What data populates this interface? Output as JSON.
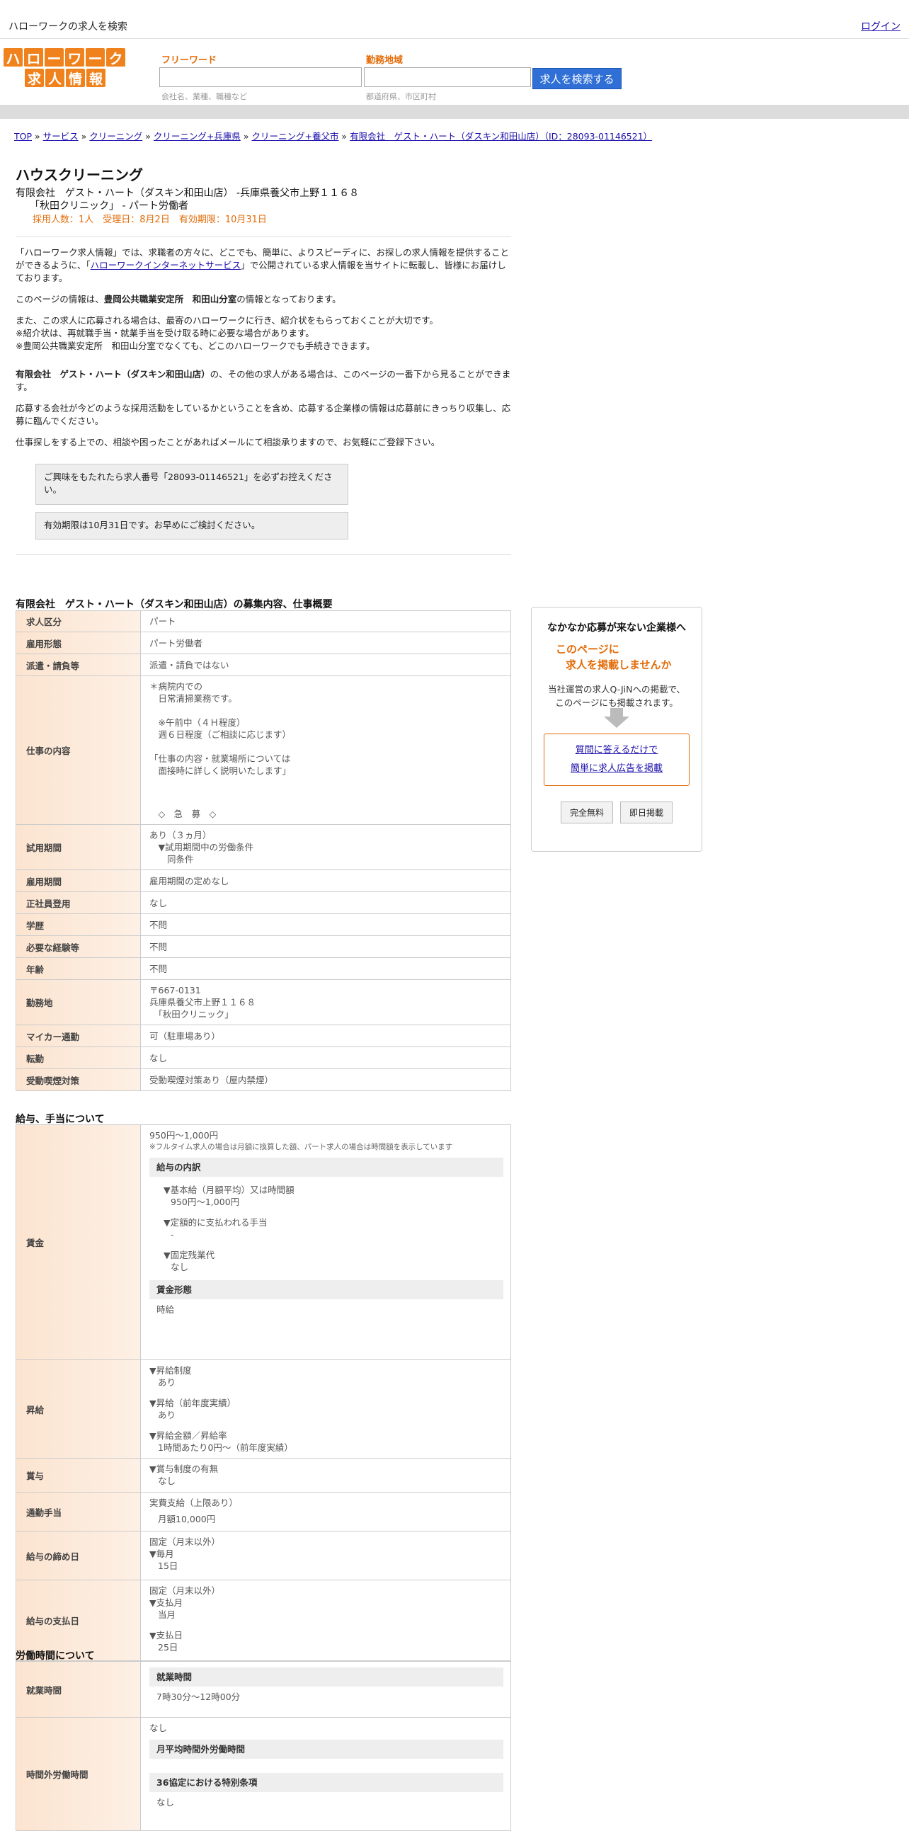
{
  "header": {
    "site_title": "ハローワークの求人を検索",
    "login": "ログイン"
  },
  "logo": {
    "line1": [
      "ハ",
      "ロ",
      "ー",
      "ワ",
      "ー",
      "ク"
    ],
    "line2": [
      "求",
      "人",
      "情",
      "報"
    ]
  },
  "search": {
    "freeword_label": "フリーワード",
    "freeword_hint": "会社名、業種、職種など",
    "area_label": "勤務地域",
    "area_hint": "都道府県、市区町村",
    "button": "求人を検索する"
  },
  "breadcrumb": {
    "items": [
      "TOP",
      "サービス",
      "クリーニング",
      "クリーニング+兵庫県",
      "クリーニング+養父市",
      "有限会社　ゲスト・ハート（ダスキン和田山店）（ID：28093-01146521）"
    ],
    "separator": " » "
  },
  "job": {
    "title": "ハウスクリーニング",
    "company_line": "有限会社　ゲスト・ハート（ダスキン和田山店） -兵庫県養父市上野１１６８",
    "clinic_line": "「秋田クリニック」 - パート労働者",
    "meta": "採用人数：1人　受理日：8月2日　有効期限：10月31日"
  },
  "intro": {
    "p1_a": "「ハローワーク求人情報」では、求職者の方々に、どこでも、簡単に、よりスピーディに、お探しの求人情報を提供することができるように、「",
    "p1_link": "ハローワークインターネットサービス",
    "p1_b": "」で公開されている求人情報を当サイトに転載し、皆様にお届けしております。",
    "p2_a": "このページの情報は、",
    "p2_bold": "豊岡公共職業安定所　和田山分室",
    "p2_b": "の情報となっております。",
    "p3_1": "また、この求人に応募される場合は、最寄のハローワークに行き、紹介状をもらっておくことが大切です。",
    "p3_2": "※紹介状は、再就職手当・就業手当を受け取る時に必要な場合があります。",
    "p3_3": "※豊岡公共職業安定所　和田山分室でなくても、どこのハローワークでも手続きできます。",
    "p4_bold": "有限会社　ゲスト・ハート（ダスキン和田山店）",
    "p4_b": "の、その他の求人がある場合は、このページの一番下から見ることができます。",
    "p5": "応募する会社が今どのような採用活動をしているかということを含め、応募する企業様の情報は応募前にきっちり収集し、応募に臨んでください。",
    "p6": "仕事探しをする上での、相談や困ったことがあればメールにて相談承りますので、お気軽にご登録下さい。",
    "notice1": "ご興味をもたれたら求人番号「28093-01146521」を必ずお控えください。",
    "notice2": "有効期限は10月31日です。お早めにご検討ください。"
  },
  "overview": {
    "heading": "有限会社　ゲスト・ハート（ダスキン和田山店）の募集内容、仕事概要",
    "rows": [
      {
        "label": "求人区分",
        "value": "パート"
      },
      {
        "label": "雇用形態",
        "value": "パート労働者"
      },
      {
        "label": "派遣・請負等",
        "value": "派遣・請負ではない"
      },
      {
        "label": "仕事の内容",
        "lines": [
          "＊病院内での",
          "　日常清掃業務です。",
          "",
          "　※午前中（４Ｈ程度）",
          "　週６日程度（ご相談に応じます）",
          "",
          "「仕事の内容・就業場所については",
          "　面接時に詳しく説明いたします」",
          "",
          "",
          "",
          "　◇　急　募　◇"
        ]
      },
      {
        "label": "試用期間",
        "lines": [
          "あり（３ヵ月）",
          "　▼試用期間中の労働条件",
          "　　同条件"
        ]
      },
      {
        "label": "雇用期間",
        "value": "雇用期間の定めなし"
      },
      {
        "label": "正社員登用",
        "value": "なし"
      },
      {
        "label": "学歴",
        "value": "不問"
      },
      {
        "label": "必要な経験等",
        "value": "不問"
      },
      {
        "label": "年齢",
        "value": "不問"
      },
      {
        "label": "勤務地",
        "lines": [
          "〒667-0131",
          "兵庫県養父市上野１１６８",
          "　「秋田クリニック」"
        ]
      },
      {
        "label": "マイカー通勤",
        "value": "可（駐車場あり）"
      },
      {
        "label": "転勤",
        "value": "なし"
      },
      {
        "label": "受動喫煙対策",
        "value": "受動喫煙対策あり（屋内禁煙）"
      }
    ]
  },
  "salary": {
    "heading": "給与、手当について",
    "wage_label": "賃金",
    "wage_range": "950円〜1,000円",
    "wage_note": "※フルタイム求人の場合は月額に換算した額、パート求人の場合は時間額を表示しています",
    "breakdown_head": "給与の内訳",
    "b1_title": "▼基本給（月額平均）又は時間額",
    "b1_value": "950円〜1,000円",
    "b2_title": "▼定額的に支払われる手当",
    "b2_value": "-",
    "b3_title": "▼固定残業代",
    "b3_value": "なし",
    "form_head": "賃金形態",
    "form_value": "時給",
    "raise_label": "昇給",
    "raise_1_title": "▼昇給制度",
    "raise_1_value": "あり",
    "raise_2_title": "▼昇給（前年度実績）",
    "raise_2_value": "あり",
    "raise_3_title": "▼昇給金額／昇給率",
    "raise_3_value": "1時間あたり0円〜（前年度実績）",
    "bonus_label": "賞与",
    "bonus_title": "▼賞与制度の有無",
    "bonus_value": "なし",
    "commute_label": "通勤手当",
    "commute_1": "実費支給（上限あり）",
    "commute_2": "月額10,000円",
    "close_label": "給与の締め日",
    "close_1": "固定（月末以外）",
    "close_2": "▼毎月",
    "close_3": "15日",
    "pay_label": "給与の支払日",
    "pay_1": "固定（月末以外）",
    "pay_2": "▼支払月",
    "pay_3": "当月",
    "pay_4": "▼支払日",
    "pay_5": "25日"
  },
  "hours": {
    "heading": "労働時間について",
    "work_label": "就業時間",
    "work_head": "就業時間",
    "work_value": "7時30分〜12時00分",
    "ot_label": "時間外労働時間",
    "ot_value": "なし",
    "ot_head1": "月平均時間外労働時間",
    "ot_head2": "36協定における特別条項",
    "ot_value2": "なし"
  },
  "ad": {
    "title": "なかなか応募が来ない企業様へ",
    "headline1": "このページに",
    "headline2": "求人を掲載しませんか",
    "body1": "当社運営の求人Q-JiNへの掲載で、",
    "body2": "このページにも掲載されます。",
    "link1": "質問に答えるだけで",
    "link2": "簡単に求人広告を掲載",
    "btn1": "完全無料",
    "btn2": "即日掲載",
    "accent": "#e36c09"
  }
}
